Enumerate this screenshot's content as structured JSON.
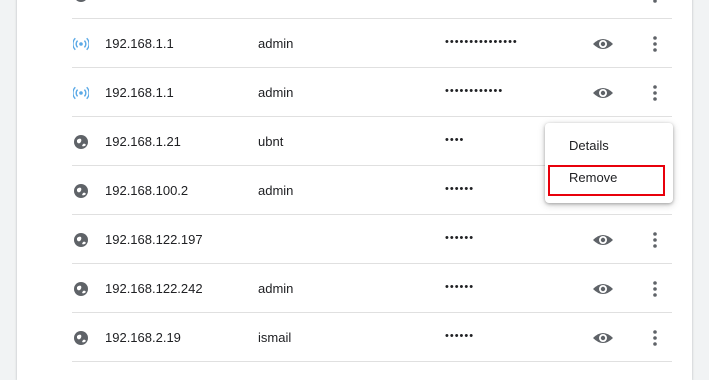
{
  "colors": {
    "accent": "#1a73e8",
    "wifi_icon": "#5aa9e6",
    "icon_gray": "#5f6368",
    "text": "#202124",
    "highlight_border": "#e8000b"
  },
  "rows": [
    {
      "site": "192.168.1.1",
      "username": "admin",
      "password_masked": "•••••••••••••••",
      "icon": "wifi-icon"
    },
    {
      "site": "192.168.1.1",
      "username": "admin",
      "password_masked": "••••••••••••",
      "icon": "wifi-icon"
    },
    {
      "site": "192.168.1.21",
      "username": "ubnt",
      "password_masked": "••••",
      "icon": "globe-icon"
    },
    {
      "site": "192.168.100.2",
      "username": "admin",
      "password_masked": "••••••",
      "icon": "globe-icon"
    },
    {
      "site": "192.168.122.197",
      "username": "",
      "password_masked": "••••••",
      "icon": "globe-icon"
    },
    {
      "site": "192.168.122.242",
      "username": "admin",
      "password_masked": "••••••",
      "icon": "globe-icon"
    },
    {
      "site": "192.168.2.19",
      "username": "ismail",
      "password_masked": "••••••",
      "icon": "globe-icon"
    }
  ],
  "context_menu": {
    "items": [
      {
        "label": "Details"
      },
      {
        "label": "Remove"
      }
    ]
  }
}
